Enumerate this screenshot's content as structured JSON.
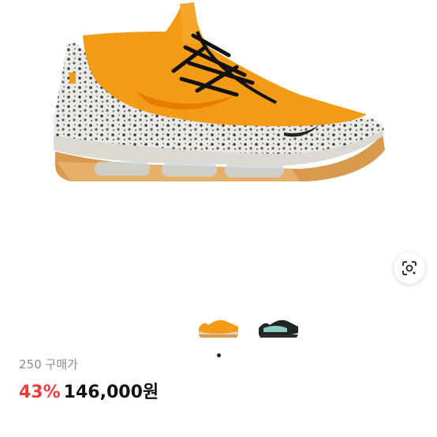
{
  "product": {
    "size_label": "250 구매가",
    "discount": "43%",
    "price": "146,000원"
  },
  "thumbnails": [
    {
      "name": "orange-safari-colorway",
      "selected": true
    },
    {
      "name": "black-teal-colorway",
      "selected": false
    }
  ],
  "icons": {
    "lens": "lens-search-icon"
  },
  "colors": {
    "discount": "#ef3b3b",
    "orange": "#f39a16",
    "gum_sole": "#d89b4e"
  }
}
